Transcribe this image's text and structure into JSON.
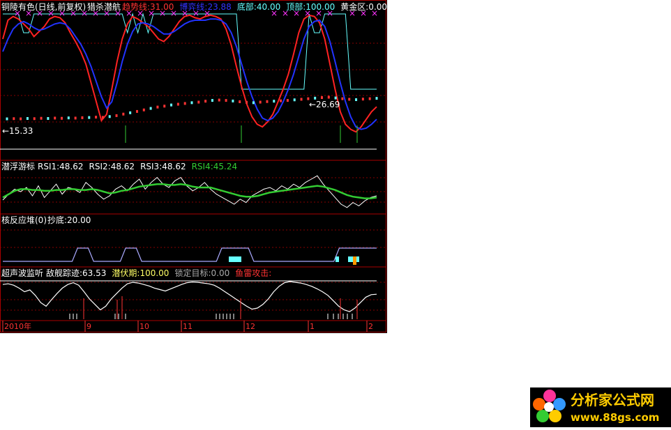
{
  "chart_data": [
    {
      "type": "line",
      "panel": "kline",
      "title": "铜陵有色(日线,前复权)",
      "indicator": "猎杀潜航",
      "labels": [
        {
          "text": "趋势线:31.00",
          "color": "#ff3333"
        },
        {
          "text": "博弈线:23.88",
          "color": "#3333ff"
        },
        {
          "text": "底部:40.00",
          "color": "#66ffff"
        },
        {
          "text": "顶部:100.00",
          "color": "#66ffff"
        },
        {
          "text": "黄金区:0.00",
          "color": "#ffffff"
        },
        {
          "text": "口",
          "color": "#ff3333"
        }
      ],
      "annotations": [
        {
          "text": "←26.69",
          "x": "1月",
          "y": 26.69
        },
        {
          "text": "←15.33",
          "x": "2010年8月",
          "y": 15.33
        }
      ],
      "series": [
        {
          "name": "趋势线",
          "color": "#ff2222",
          "values": [
            80,
            95,
            98,
            96,
            92,
            88,
            82,
            86,
            90,
            96,
            98,
            97,
            93,
            85,
            78,
            70,
            60,
            45,
            30,
            15,
            20,
            40,
            62,
            80,
            92,
            98,
            96,
            93,
            90,
            85,
            80,
            78,
            82,
            88,
            94,
            98,
            99,
            97,
            96,
            98,
            99,
            98,
            96,
            88,
            75,
            58,
            42,
            28,
            18,
            12,
            10,
            14,
            20,
            30,
            40,
            52,
            68,
            85,
            96,
            99,
            98,
            93,
            80,
            60,
            40,
            22,
            12,
            8,
            6,
            10,
            16,
            22,
            26
          ]
        },
        {
          "name": "博弈线",
          "color": "#2233ff",
          "values": [
            70,
            80,
            88,
            92,
            94,
            92,
            89,
            87,
            88,
            90,
            92,
            93,
            92,
            88,
            82,
            76,
            68,
            58,
            46,
            34,
            25,
            30,
            45,
            62,
            76,
            86,
            92,
            93,
            92,
            90,
            87,
            84,
            84,
            86,
            89,
            92,
            94,
            95,
            95,
            95,
            96,
            96,
            95,
            92,
            85,
            74,
            60,
            46,
            34,
            24,
            17,
            15,
            17,
            22,
            30,
            40,
            52,
            66,
            80,
            90,
            94,
            95,
            90,
            78,
            62,
            45,
            30,
            18,
            10,
            8,
            9,
            12,
            16
          ]
        },
        {
          "name": "底部/顶部",
          "color": "#66ffff",
          "values": [
            100,
            100,
            100,
            100,
            85,
            85,
            100,
            100,
            100,
            100,
            100,
            100,
            100,
            100,
            100,
            100,
            100,
            100,
            100,
            100,
            100,
            100,
            100,
            100,
            85,
            100,
            85,
            100,
            85,
            100,
            100,
            100,
            100,
            100,
            100,
            100,
            100,
            100,
            100,
            100,
            100,
            100,
            100,
            100,
            100,
            100,
            40,
            40,
            40,
            40,
            40,
            40,
            40,
            40,
            40,
            40,
            40,
            40,
            40,
            100,
            85,
            85,
            100,
            100,
            100,
            100,
            100,
            40,
            40,
            40,
            40,
            40,
            40
          ]
        }
      ],
      "price_values": [
        15.3,
        15.4,
        15.3,
        15.5,
        15.4,
        15.6,
        15.5,
        15.7,
        15.6,
        15.8,
        15.7,
        15.9,
        16.0,
        16.2,
        16.1,
        16.5,
        17.0,
        17.8,
        18.5,
        19.2,
        20.0,
        20.8,
        21.5,
        22.0,
        22.6,
        23.0,
        23.4,
        23.8,
        24.1,
        24.6,
        25.0,
        25.2,
        25.0,
        24.7,
        24.3,
        24.0,
        23.8,
        24.1,
        24.4,
        24.6,
        24.8,
        25.0,
        25.3,
        25.6,
        25.9,
        26.2,
        26.5,
        26.69,
        26.3,
        25.9,
        25.6,
        25.4,
        25.7,
        25.9,
        26.1
      ]
    },
    {
      "type": "line",
      "panel": "rsi",
      "title": "潜浮游标",
      "labels": [
        {
          "text": "RSI1:48.62",
          "color": "#ffffff"
        },
        {
          "text": "RSI2:48.62",
          "color": "#ffffff"
        },
        {
          "text": "RSI3:48.62",
          "color": "#ffffff"
        },
        {
          "text": "RSI4:45.24",
          "color": "#33cc33"
        }
      ],
      "series": [
        {
          "name": "RSI1",
          "color": "#ffffff",
          "values": [
            45,
            52,
            58,
            55,
            60,
            50,
            62,
            48,
            56,
            64,
            52,
            60,
            58,
            54,
            66,
            60,
            52,
            46,
            50,
            58,
            62,
            56,
            64,
            70,
            58,
            66,
            72,
            64,
            60,
            68,
            72,
            62,
            56,
            60,
            66,
            58,
            52,
            48,
            44,
            40,
            46,
            42,
            50,
            54,
            58,
            60,
            56,
            62,
            58,
            64,
            60,
            66,
            70,
            74,
            64,
            56,
            48,
            40,
            36,
            42,
            38,
            44,
            48,
            50
          ]
        },
        {
          "name": "RSI4",
          "color": "#33cc33",
          "values": [
            48,
            52,
            56,
            58,
            58,
            57,
            57,
            56,
            56,
            57,
            57,
            58,
            58,
            57,
            57,
            58,
            57,
            55,
            53,
            54,
            56,
            57,
            59,
            61,
            62,
            63,
            64,
            64,
            63,
            63,
            64,
            63,
            61,
            60,
            60,
            60,
            58,
            56,
            54,
            52,
            50,
            49,
            49,
            50,
            52,
            54,
            55,
            56,
            57,
            58,
            59,
            60,
            61,
            62,
            61,
            59,
            57,
            54,
            51,
            49,
            48,
            47,
            47,
            48
          ]
        }
      ]
    },
    {
      "type": "line",
      "panel": "hefanying",
      "title": "核反应堆(0)",
      "labels": [
        {
          "text": "抄底:20.00",
          "color": "#ffffff"
        }
      ],
      "series": [
        {
          "name": "抄底",
          "color": "#aaaaff",
          "values": [
            0,
            0,
            0,
            0,
            0,
            0,
            0,
            0,
            0,
            0,
            0,
            0,
            0,
            0,
            1,
            1,
            1,
            0,
            0,
            0,
            0,
            0,
            0,
            1,
            1,
            1,
            0,
            0,
            0,
            0,
            0,
            0,
            0,
            0,
            0,
            0,
            0,
            0,
            0,
            0,
            0,
            1,
            1,
            1,
            1,
            1,
            1,
            0,
            0,
            0,
            0,
            0,
            0,
            0,
            0,
            0,
            0,
            0,
            0,
            0,
            0,
            0,
            0,
            1,
            1,
            1,
            1,
            1,
            1,
            1,
            1
          ]
        }
      ]
    },
    {
      "type": "line",
      "panel": "chaoshengbo",
      "title": "超声波监听",
      "labels": [
        {
          "text": "敌舰踪迹:63.53",
          "color": "#ffffff"
        },
        {
          "text": "潜伏期:100.00",
          "color": "#ffff66"
        },
        {
          "text": "锁定目标:0.00",
          "color": "#aaaaaa"
        },
        {
          "text": "鱼雷攻击:",
          "color": "#ff3333"
        }
      ],
      "series": [
        {
          "name": "敌舰踪迹",
          "color": "#ffffff",
          "values": [
            90,
            92,
            88,
            80,
            70,
            75,
            60,
            40,
            30,
            48,
            65,
            80,
            90,
            95,
            88,
            70,
            50,
            35,
            20,
            30,
            50,
            65,
            80,
            92,
            96,
            94,
            90,
            86,
            80,
            76,
            72,
            78,
            84,
            90,
            95,
            97,
            96,
            94,
            92,
            88,
            80,
            70,
            60,
            50,
            40,
            30,
            22,
            25,
            35,
            50,
            70,
            85,
            95,
            98,
            96,
            94,
            90,
            85,
            78,
            70,
            60,
            45,
            30,
            20,
            15,
            25,
            40,
            55,
            62,
            63
          ]
        }
      ]
    }
  ],
  "x_axis": {
    "labels": [
      "2010年",
      "9",
      "10",
      "11",
      "12",
      "1",
      "2"
    ],
    "color": "#ff3333"
  },
  "logo": {
    "text": "分析家公式网",
    "url_text": "www.88gs.com"
  }
}
